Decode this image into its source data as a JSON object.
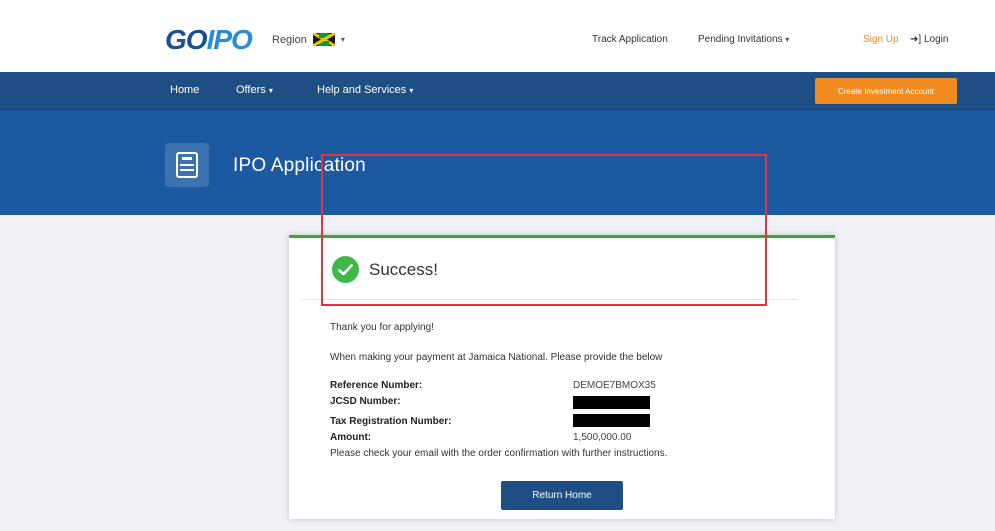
{
  "header": {
    "logo_go": "GO",
    "logo_ipo": "IPO",
    "region_label": "Region",
    "region_flag": "jamaica-flag",
    "links": {
      "track_application": "Track Application",
      "pending_invitations": "Pending Invitations",
      "sign_up": "Sign Up",
      "login": "Login"
    }
  },
  "navbar": {
    "items": [
      "Home",
      "Offers",
      "Help and Services"
    ],
    "cta_label": "Create Investment Account"
  },
  "hero": {
    "title": "IPO Application"
  },
  "card": {
    "success_title": "Success!",
    "thank_you": "Thank you for applying!",
    "payment_instruction": "When making your payment at Jamaica National. Please provide the below",
    "fields": [
      {
        "label": "Reference Number:",
        "value": "DEMOE7BMOX35"
      },
      {
        "label": "JCSD Number:",
        "value": ""
      },
      {
        "label": "Tax Registration Number:",
        "value": ""
      },
      {
        "label": "Amount:",
        "value": "1,500,000.00"
      }
    ],
    "email_note": "Please check your email with the order confirmation with further instructions.",
    "return_button": "Return Home"
  },
  "colors": {
    "brand_blue": "#1f4e85",
    "hero_blue": "#1b5aa0",
    "accent_orange": "#f18a1f",
    "success_green": "#3fb84a",
    "highlight_red": "#e2343d"
  }
}
